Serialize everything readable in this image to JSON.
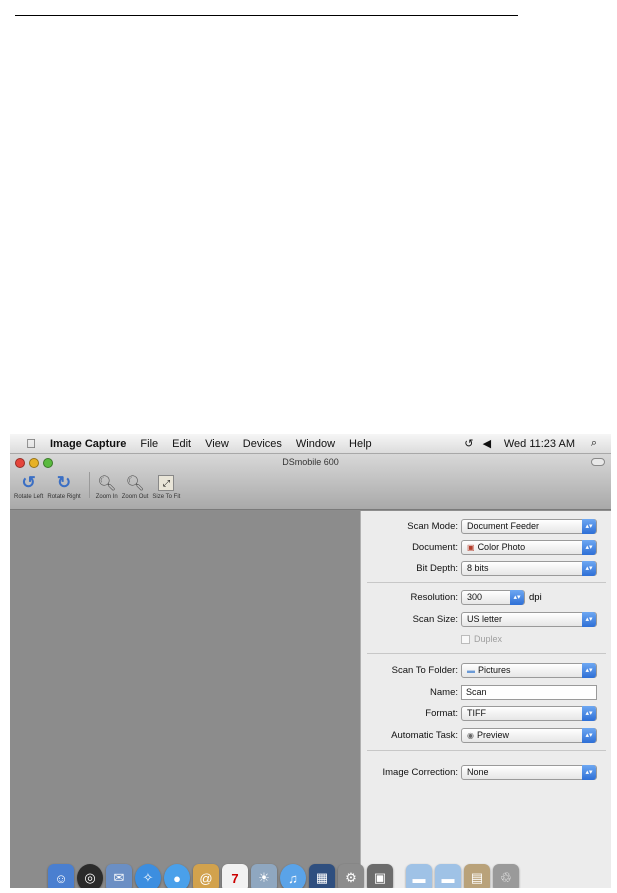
{
  "menubar": {
    "app_name": "Image Capture",
    "items": [
      "File",
      "Edit",
      "View",
      "Devices",
      "Window",
      "Help"
    ],
    "clock": "Wed 11:23 AM"
  },
  "window": {
    "title": "DSmobile 600"
  },
  "toolbar": {
    "rotate_left": "Rotate Left",
    "rotate_right": "Rotate Right",
    "zoom_in": "Zoom In",
    "zoom_out": "Zoom Out",
    "size_to_fit": "Size To Fit"
  },
  "settings": {
    "scan_mode": {
      "label": "Scan Mode:",
      "value": "Document Feeder"
    },
    "document": {
      "label": "Document:",
      "value": "Color Photo"
    },
    "bit_depth": {
      "label": "Bit Depth:",
      "value": "8 bits"
    },
    "resolution": {
      "label": "Resolution:",
      "value": "300",
      "unit": "dpi"
    },
    "scan_size": {
      "label": "Scan Size:",
      "value": "US letter"
    },
    "duplex": {
      "label": "Duplex",
      "checked": false,
      "enabled": false
    },
    "scan_to_folder": {
      "label": "Scan To Folder:",
      "value": "Pictures"
    },
    "name": {
      "label": "Name:",
      "value": "Scan"
    },
    "format": {
      "label": "Format:",
      "value": "TIFF"
    },
    "automatic_task": {
      "label": "Automatic Task:",
      "value": "Preview"
    },
    "image_correction": {
      "label": "Image Correction:",
      "value": "None"
    }
  },
  "dock": {
    "icons": [
      "finder-icon",
      "dashboard-icon",
      "mail-icon",
      "safari-icon",
      "ichat-icon",
      "address-book-icon",
      "ical-icon",
      "iphoto-icon",
      "itunes-icon",
      "spaces-icon",
      "system-preferences-icon",
      "image-capture-icon",
      "documents-folder-icon",
      "downloads-folder-icon",
      "applications-stack-icon",
      "trash-icon"
    ]
  },
  "colors": {
    "accent": "#2e6fd6",
    "panel_bg": "#ececec",
    "preview_bg": "#8c8c8c"
  }
}
